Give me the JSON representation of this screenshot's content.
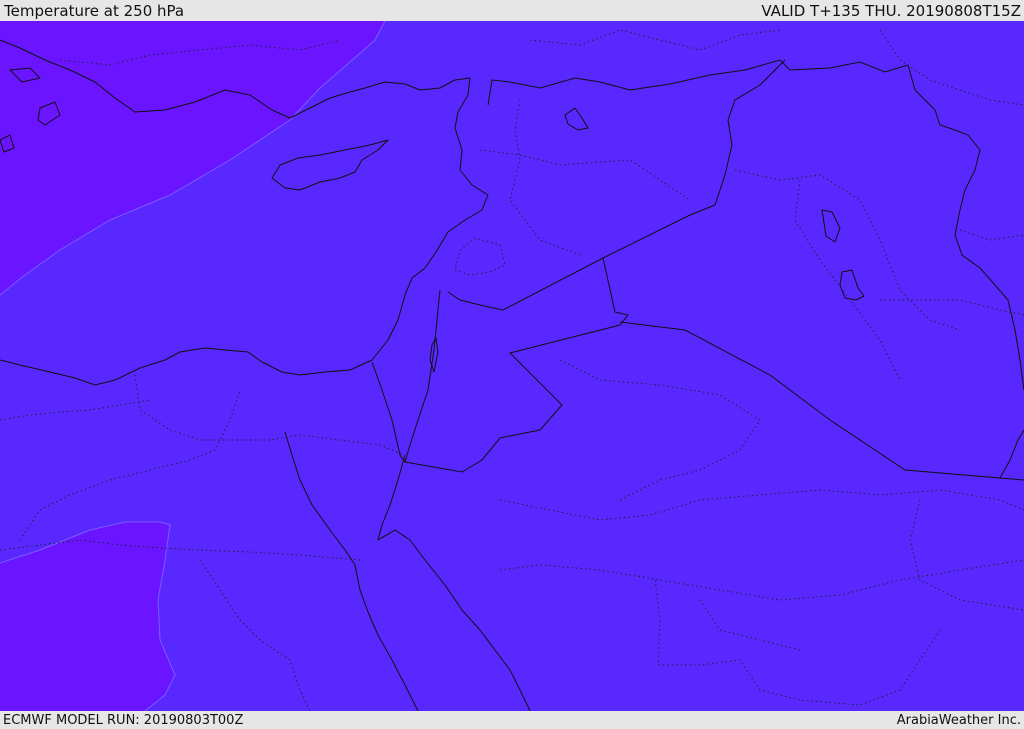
{
  "header": {
    "title": "Temperature at 250 hPa",
    "valid": "VALID T+135 THU. 20190808T15Z"
  },
  "footer": {
    "model_run": "ECMWF MODEL RUN: 20190803T00Z",
    "credit": "ArabiaWeather Inc."
  },
  "colors": {
    "background": "#e6e6e6",
    "field_main": "#5828ff",
    "field_cold": "#6b14ff",
    "boundary": "#111111"
  }
}
